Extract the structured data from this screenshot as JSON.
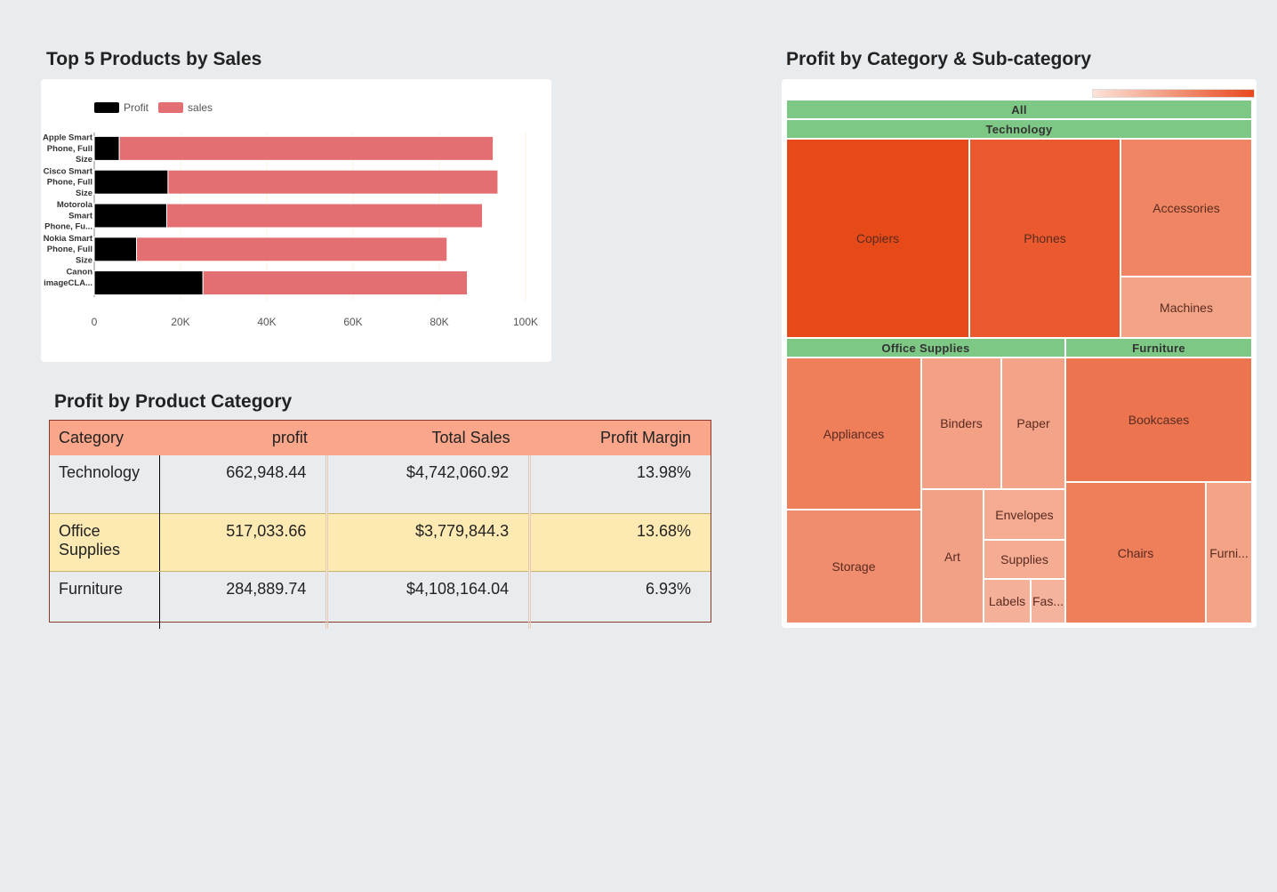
{
  "bar_section": {
    "title": "Top 5 Products by Sales"
  },
  "table_section": {
    "title": "Profit by Product Category"
  },
  "tree_section": {
    "title": "Profit by Category & Sub-category"
  },
  "chart_data": {
    "type": "bar",
    "orientation": "horizontal",
    "categories": [
      [
        "Apple Smart",
        "Phone, Full",
        "Size"
      ],
      [
        "Cisco Smart",
        "Phone, Full",
        "Size"
      ],
      [
        "Motorola",
        "Smart",
        "Phone, Fu..."
      ],
      [
        "Nokia Smart",
        "Phone, Full",
        "Size"
      ],
      [
        "Canon",
        "imageCLA..."
      ]
    ],
    "series": [
      {
        "name": "Profit",
        "color": "#000000",
        "values": [
          5800,
          17100,
          16800,
          9800,
          25200
        ]
      },
      {
        "name": "sales",
        "color": "#e46f72",
        "values": [
          86700,
          76500,
          73200,
          72000,
          61300
        ]
      }
    ],
    "stacked": true,
    "xlim": [
      0,
      100000
    ],
    "xticks": [
      "0",
      "20K",
      "40K",
      "60K",
      "80K",
      "100K"
    ],
    "legend_position": "top-left"
  },
  "table": {
    "headers": [
      "Category",
      "profit",
      "Total Sales",
      "Profit Margin"
    ],
    "rows": [
      {
        "category": "Technology",
        "profit": "662,948.44",
        "sales": "$4,742,060.92",
        "margin": "13.98%"
      },
      {
        "category": "Office Supplies",
        "profit": "517,033.66",
        "sales": "$3,779,844.3",
        "margin": "13.68%"
      },
      {
        "category": "Furniture",
        "profit": "284,889.74",
        "sales": "$4,108,164.04",
        "margin": "6.93%"
      }
    ]
  },
  "treemap": {
    "root": "All",
    "groups": [
      {
        "name": "Technology",
        "children": [
          "Copiers",
          "Phones",
          "Accessories",
          "Machines"
        ]
      },
      {
        "name": "Office Supplies",
        "children": [
          "Appliances",
          "Storage",
          "Binders",
          "Paper",
          "Art",
          "Envelopes",
          "Supplies",
          "Labels",
          "Fas..."
        ]
      },
      {
        "name": "Furniture",
        "children": [
          "Bookcases",
          "Chairs",
          "Furni..."
        ]
      }
    ]
  }
}
